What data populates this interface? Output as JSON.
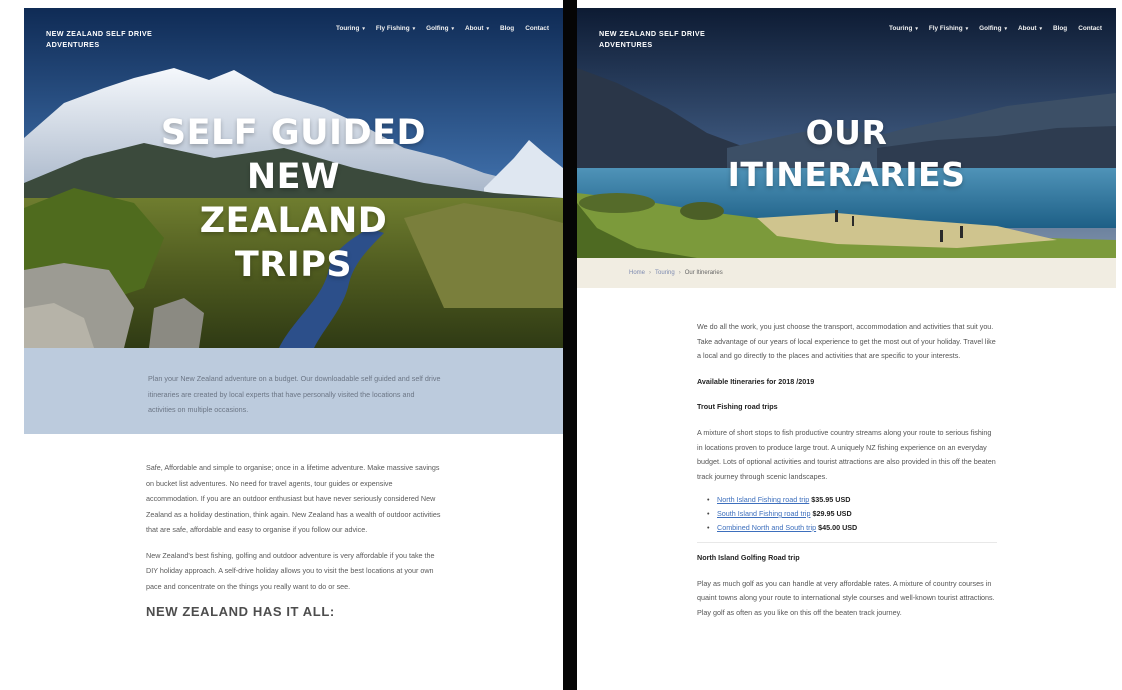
{
  "left": {
    "brand": "NEW ZEALAND SELF DRIVE ADVENTURES",
    "nav": [
      {
        "label": "Touring",
        "dropdown": true
      },
      {
        "label": "Fly Fishing",
        "dropdown": true
      },
      {
        "label": "Golfing",
        "dropdown": true
      },
      {
        "label": "About",
        "dropdown": true
      },
      {
        "label": "Blog",
        "dropdown": false
      },
      {
        "label": "Contact",
        "dropdown": false
      }
    ],
    "hero_lines": [
      "SELF GUIDED",
      "NEW",
      "ZEALAND",
      "TRIPS"
    ],
    "intro": "Plan your New Zealand adventure on a budget. Our downloadable self guided and self drive itineraries are created by local experts that have personally visited the locations and activities on multiple occasions.",
    "para1": "Safe, Affordable and simple to organise; once in a lifetime adventure. Make massive savings on bucket list adventures. No need for travel agents, tour guides or expensive accommodation. If you are an outdoor enthusiast but have never seriously considered New Zealand as a holiday destination, think again. New Zealand has a wealth of outdoor activities that are safe, affordable and easy to organise if you follow our advice.",
    "para2": "New Zealand's best fishing, golfing and outdoor adventure is very affordable if you take the DIY holiday approach. A self-drive holiday allows you to visit the best locations at your own pace and concentrate on the things you really want to do or see.",
    "heading": "NEW ZEALAND HAS IT ALL:"
  },
  "right": {
    "brand": "NEW ZEALAND SELF DRIVE ADVENTURES",
    "nav": [
      {
        "label": "Touring",
        "dropdown": true
      },
      {
        "label": "Fly Fishing",
        "dropdown": true
      },
      {
        "label": "Golfing",
        "dropdown": true
      },
      {
        "label": "About",
        "dropdown": true
      },
      {
        "label": "Blog",
        "dropdown": false
      },
      {
        "label": "Contact",
        "dropdown": false
      }
    ],
    "hero_lines": [
      "OUR",
      "ITINERARIES"
    ],
    "breadcrumb": [
      "Home",
      "Touring",
      "Our Itineraries"
    ],
    "intro": "We do all the work, you just choose the transport, accommodation and activities that suit you. Take advantage of our years of local experience to get the most out of your holiday. Travel like a local and go directly to the places and activities that are specific to your interests.",
    "available_heading": "Available Itineraries for 2018 /2019",
    "trout_heading": "Trout Fishing road trips",
    "trout_text": "A mixture of short stops to fish productive country streams along your route to serious fishing in locations proven to produce large trout. A uniquely NZ fishing experience on an everyday budget. Lots of optional activities and tourist attractions are also provided in this off the beaten track journey through scenic landscapes.",
    "trips": [
      {
        "link": "North Island Fishing road trip",
        "price": "$35.95 USD"
      },
      {
        "link": "South Island Fishing road trip",
        "price": "$29.95 USD"
      },
      {
        "link": "Combined North and South trip",
        "price": "$45.00 USD"
      }
    ],
    "golf_heading": "North Island Golfing Road trip",
    "golf_text": "Play as much golf as you can handle at very affordable rates. A mixture of country courses in quaint towns along your route to international style courses and well-known tourist attractions. Play golf as often as you like on this off the beaten track journey."
  },
  "colors": {
    "band": "#bccbdd",
    "link": "#3d6fbd",
    "divider": "#050505",
    "breadcrumb_bg": "#f1ede2"
  },
  "icons": [
    "chevron-down-icon",
    "bullet-icon"
  ]
}
